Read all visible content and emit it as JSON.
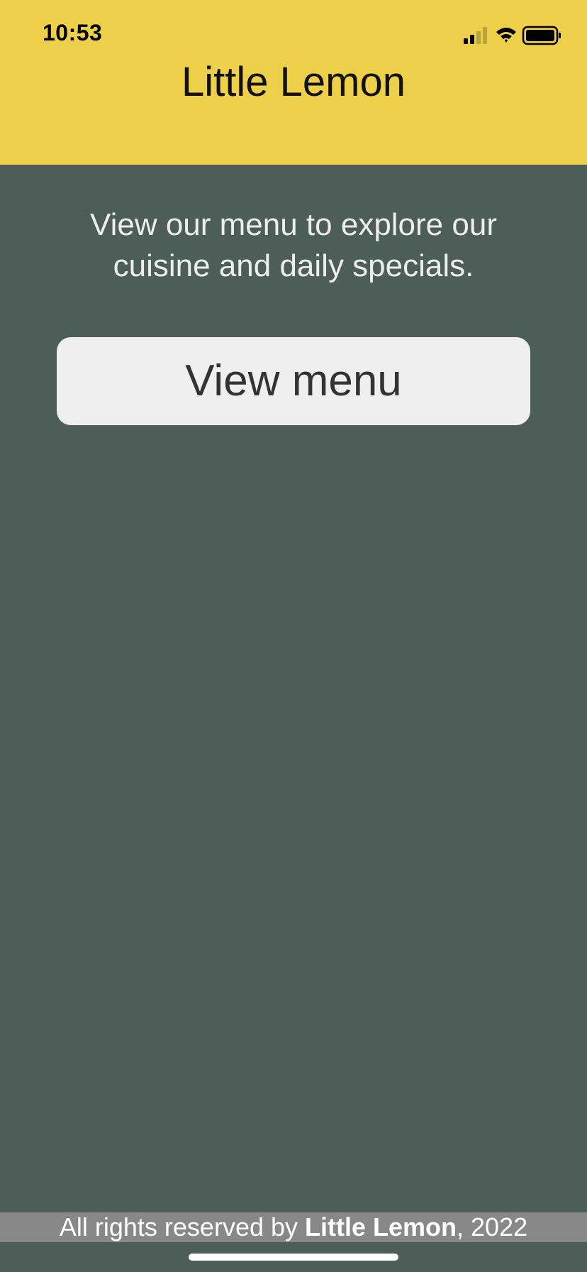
{
  "status_bar": {
    "time": "10:53",
    "icons": [
      "cellular-signal-icon",
      "wifi-icon",
      "battery-icon"
    ]
  },
  "header": {
    "title": "Little Lemon",
    "background": "#eecf4a"
  },
  "main": {
    "intro_text": "View our menu to explore our cuisine and daily specials.",
    "view_menu_label": "View menu",
    "background": "#4c5e57"
  },
  "footer": {
    "prefix": "All rights reserved by ",
    "brand": "Little Lemon",
    "suffix": ", 2022"
  }
}
